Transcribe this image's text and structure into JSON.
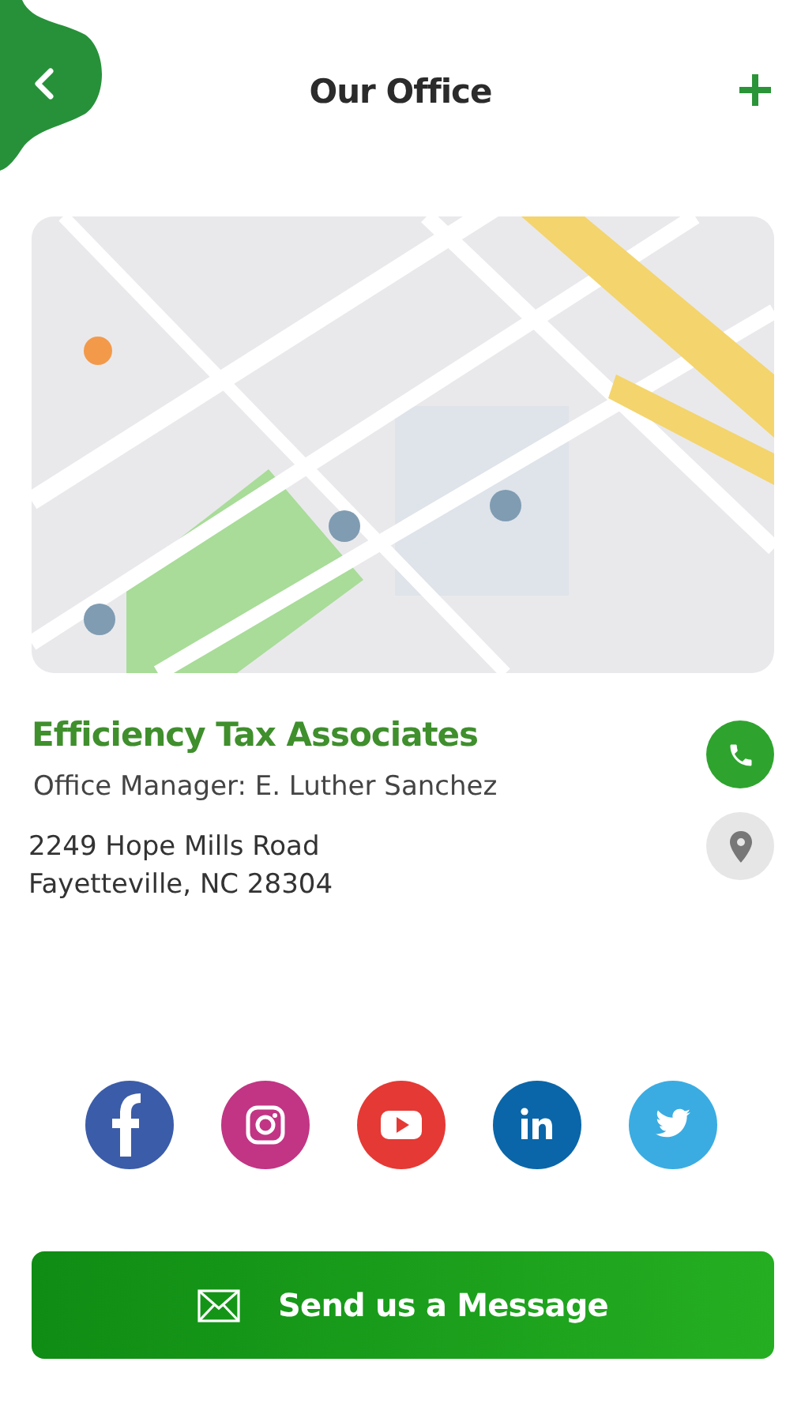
{
  "header": {
    "title": "Our Office"
  },
  "office": {
    "name": "Efficiency Tax Associates",
    "manager": "Office Manager: E. Luther Sanchez",
    "address_lines": [
      "2249 Hope Mills Road",
      "Fayetteville, NC 28304"
    ]
  },
  "actions": [
    {
      "kind": "phone",
      "color": "#2ea42e"
    },
    {
      "kind": "location",
      "color": "#e6e6e6"
    }
  ],
  "social": [
    {
      "kind": "facebook",
      "color": "#3b5ca8"
    },
    {
      "kind": "instagram",
      "color": "#c13584"
    },
    {
      "kind": "youtube",
      "color": "#e53935"
    },
    {
      "kind": "linkedin",
      "color": "#0a66a8"
    },
    {
      "kind": "twitter",
      "color": "#3aace2"
    }
  ],
  "message_button": {
    "label": "Send us a Message"
  }
}
